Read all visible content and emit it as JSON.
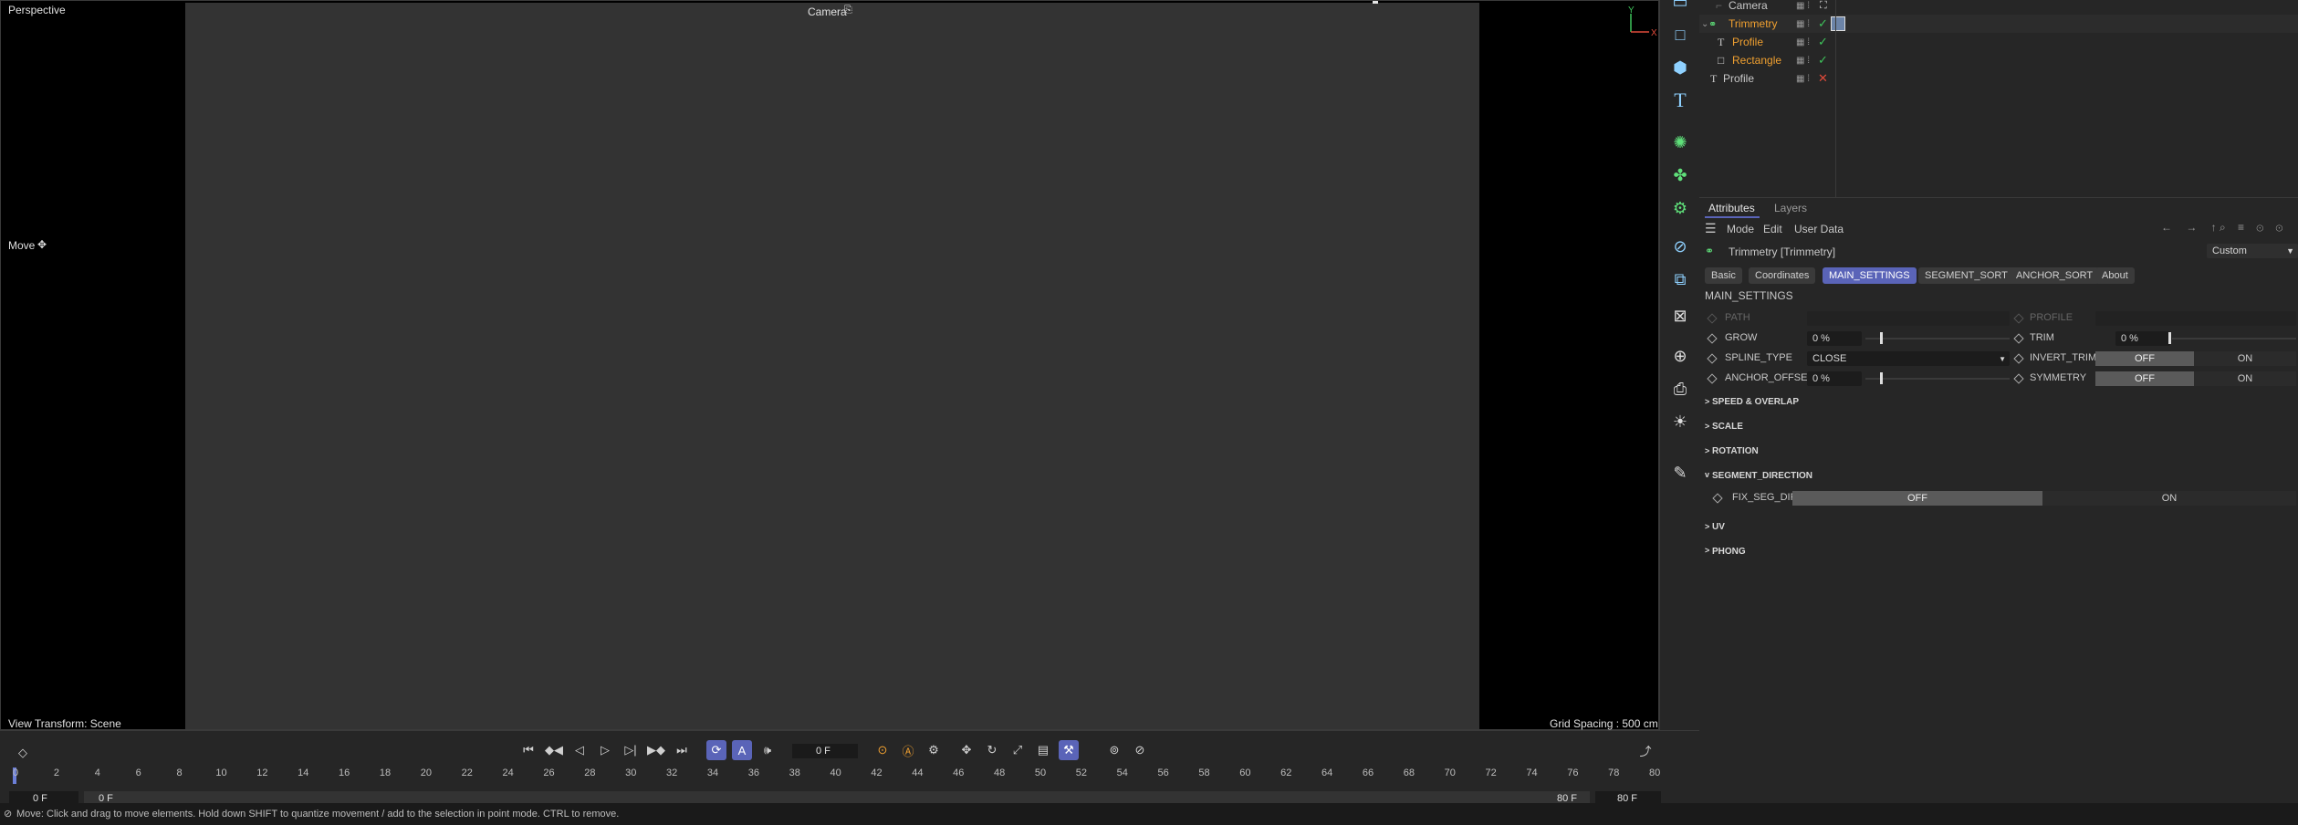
{
  "viewport": {
    "view_name": "Perspective",
    "camera_label": "Camera",
    "tool_label": "Move",
    "view_transform": "View Transform: Scene",
    "grid_spacing": "Grid Spacing : 500 cm",
    "axis_y": "Y",
    "axis_x": "X"
  },
  "object_manager": {
    "items": [
      {
        "name": "Camera",
        "color": "#c8c8c8",
        "status": "none"
      },
      {
        "name": "Trimmetry",
        "color": "#f0a030",
        "status": "tick"
      },
      {
        "name": "Profile",
        "color": "#f0a030",
        "status": "tick"
      },
      {
        "name": "Rectangle",
        "color": "#f0a030",
        "status": "tick"
      },
      {
        "name": "Profile",
        "color": "#c8c8c8",
        "status": "cross"
      }
    ]
  },
  "attributes": {
    "tabs": [
      "Attributes",
      "Layers"
    ],
    "menu": [
      "Mode",
      "Edit",
      "User Data"
    ],
    "object_title": "Trimmetry [Trimmetry]",
    "preset": "Custom",
    "segment_tabs": [
      "Basic",
      "Coordinates",
      "MAIN_SETTINGS",
      "SEGMENT_SORT",
      "ANCHOR_SORT",
      "About"
    ],
    "active_tab": "MAIN_SETTINGS",
    "section_title": "MAIN_SETTINGS",
    "props": {
      "path": "PATH",
      "profile": "PROFILE",
      "grow": "GROW",
      "grow_value": "0 %",
      "trim": "TRIM",
      "trim_value": "0 %",
      "spline_type": "SPLINE_TYPE",
      "spline_type_value": "CLOSE",
      "invert_trim": "INVERT_TRIM",
      "anchor_offset": "ANCHOR_OFFSET",
      "anchor_offset_value": "0 %",
      "symmetry": "SYMMETRY",
      "off": "OFF",
      "on": "ON"
    },
    "groups": [
      "SPEED & OVERLAP",
      "SCALE",
      "ROTATION",
      "SEGMENT_DIRECTION",
      "UV",
      "PHONG"
    ],
    "fix_seg_dir": "FIX_SEG_DIR"
  },
  "timeline": {
    "current_frame": "0 F",
    "start_frame": "0 F",
    "start_frame2": "0 F",
    "end_frame": "80 F",
    "end_frame2": "80 F",
    "ruler": [
      "0",
      "2",
      "4",
      "6",
      "8",
      "10",
      "12",
      "14",
      "16",
      "18",
      "20",
      "22",
      "24",
      "26",
      "28",
      "30",
      "32",
      "34",
      "36",
      "38",
      "40",
      "42",
      "44",
      "46",
      "48",
      "50",
      "52",
      "54",
      "56",
      "58",
      "60",
      "62",
      "64",
      "66",
      "68",
      "70",
      "72",
      "74",
      "76",
      "78",
      "80"
    ]
  },
  "status_text": "Move: Click and drag to move elements. Hold down SHIFT to quantize movement / add to the selection in point mode. CTRL to remove."
}
